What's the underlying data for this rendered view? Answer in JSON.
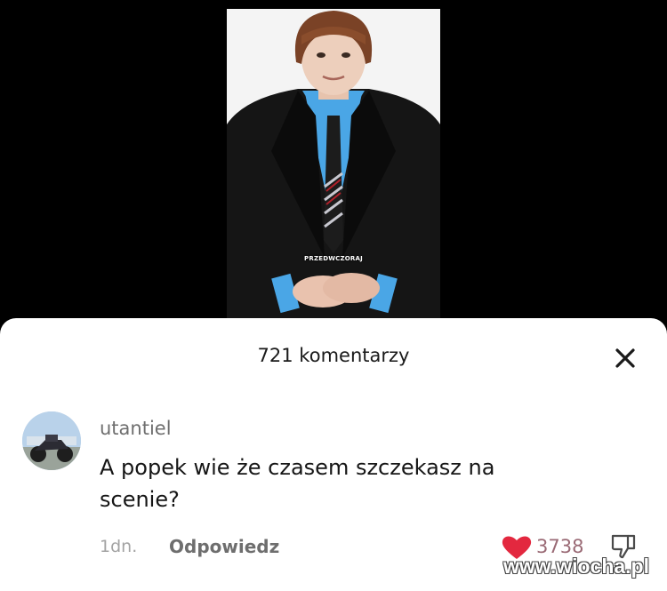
{
  "video": {
    "overlay_text": "PRZEDWCZORAJ",
    "colors": {
      "background": "#000000",
      "frame": "#f4f4f4",
      "shirt": "#4aa6e6",
      "suit": "#151515",
      "hair": "#7a4226"
    }
  },
  "comments_sheet": {
    "title": "721 komentarzy",
    "close_icon": "close-icon"
  },
  "comment": {
    "username": "utantiel",
    "text": "A popek wie że czasem szczekasz na scenie?",
    "time": "1dn.",
    "reply_label": "Odpowiedz",
    "like_count": "3738",
    "liked": true,
    "colors": {
      "heart": "#e3283f"
    }
  },
  "watermark": {
    "text": "www.wiocha.pl"
  }
}
